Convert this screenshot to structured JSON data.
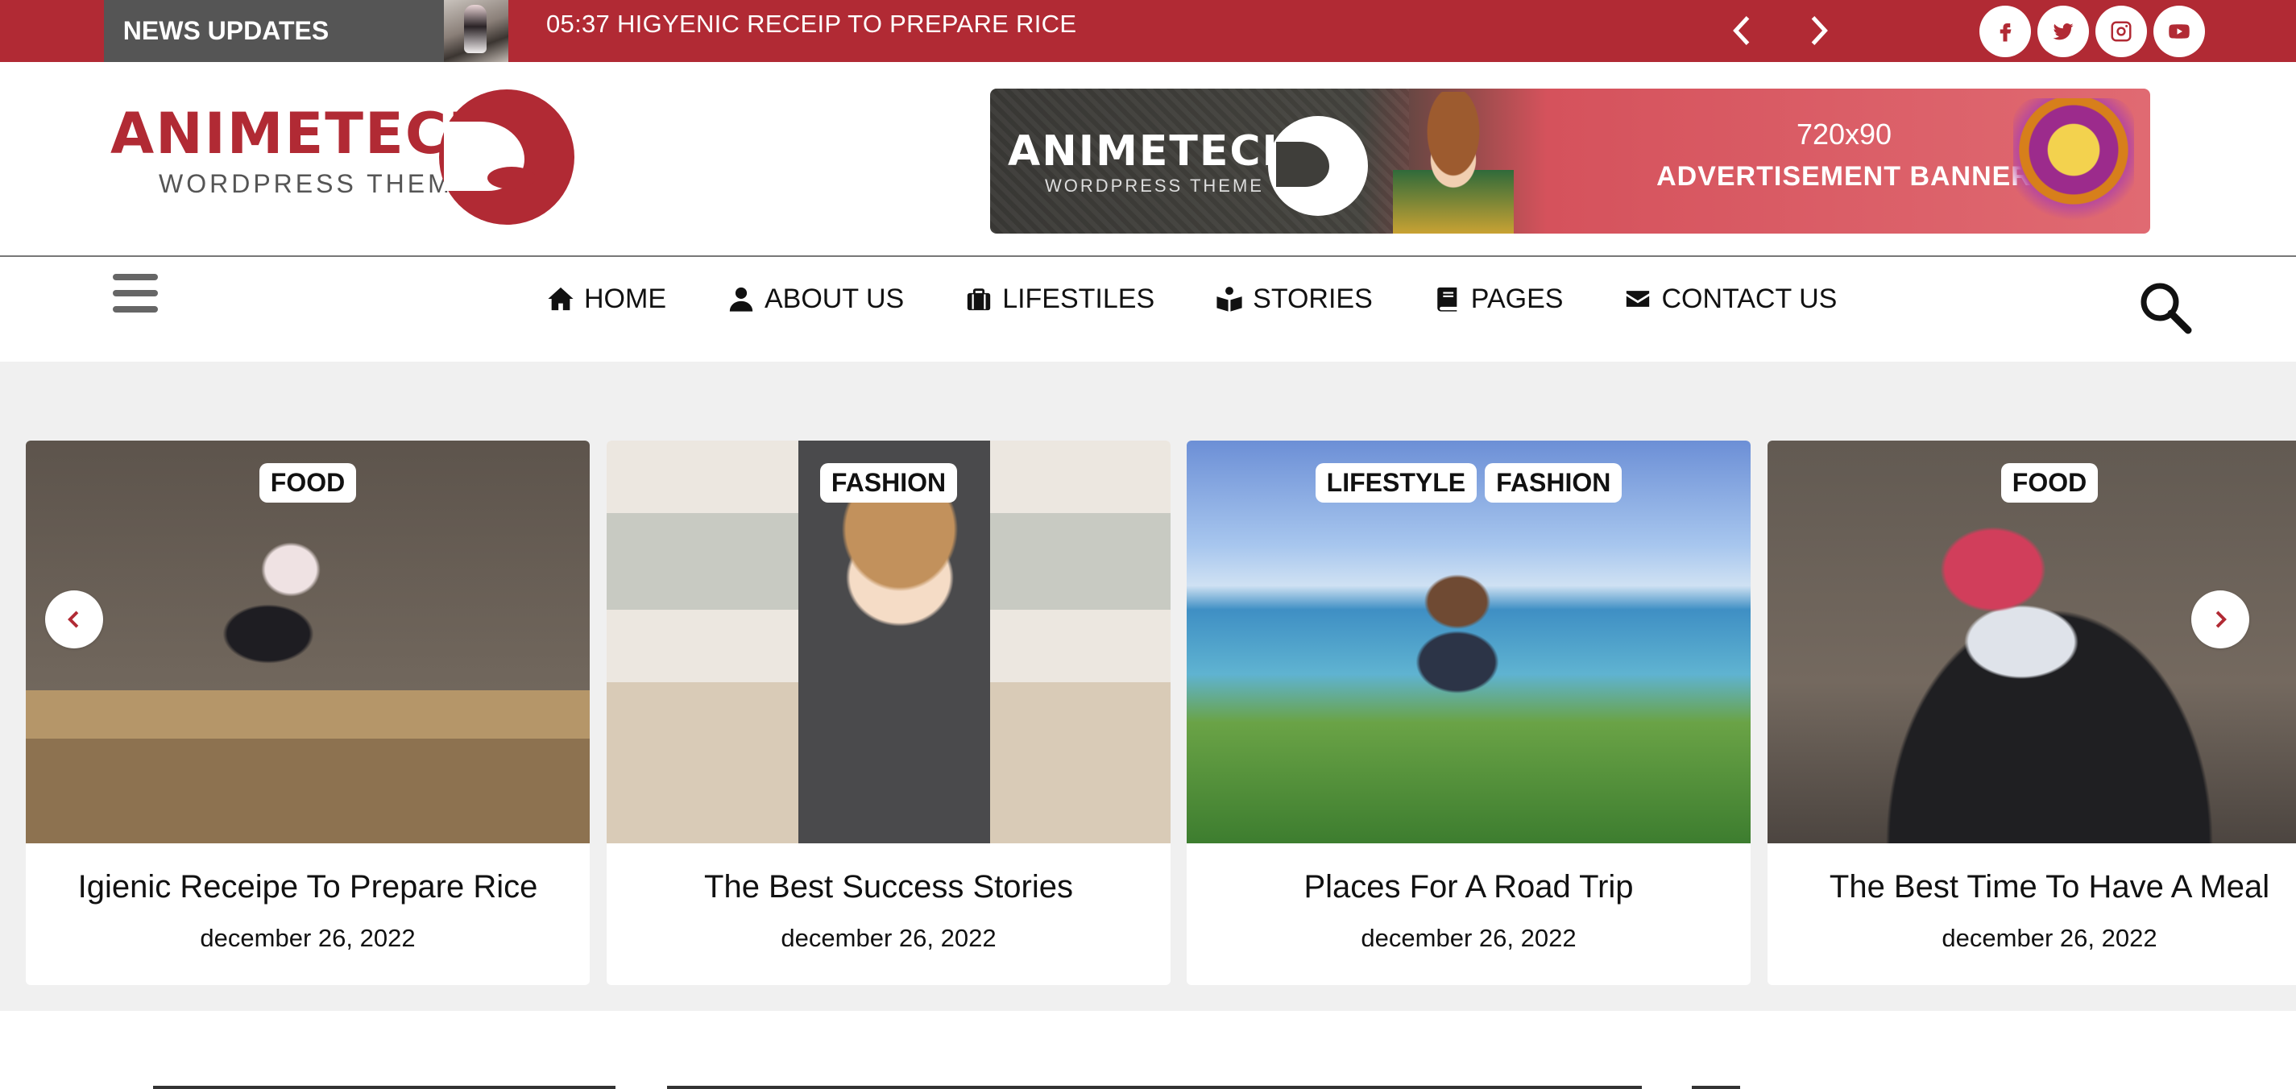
{
  "topbar": {
    "news_label": "NEWS UPDATES",
    "ticker_text": "05:37 HIGYENIC RECEIP TO PREPARE RICE",
    "prev_icon": "chevron-left-icon",
    "next_icon": "chevron-right-icon",
    "social": [
      "facebook-icon",
      "twitter-icon",
      "instagram-icon",
      "youtube-icon"
    ],
    "accent_color": "#b12a34"
  },
  "header": {
    "logo_text": "ANIMETECH",
    "logo_subtext": "WORDPRESS THEME",
    "banner": {
      "logo_text": "ANIMETECH",
      "logo_subtext": "WORDPRESS THEME",
      "size_text": "720x90",
      "ad_text": "ADVERTISEMENT BANNER"
    }
  },
  "nav": {
    "items": [
      {
        "label": "HOME",
        "icon": "home-icon"
      },
      {
        "label": "ABOUT US",
        "icon": "user-icon"
      },
      {
        "label": "LIFESTILES",
        "icon": "suitcase-icon"
      },
      {
        "label": "STORIES",
        "icon": "book-open-icon"
      },
      {
        "label": "PAGES",
        "icon": "book-icon"
      },
      {
        "label": "CONTACT US",
        "icon": "envelope-icon"
      }
    ],
    "menu_icon": "hamburger-icon",
    "search_icon": "search-icon"
  },
  "slider": {
    "cards": [
      {
        "tags": [
          "FOOD"
        ],
        "title": "Igienic Receipe To Prepare Rice",
        "date": "december 26, 2022"
      },
      {
        "tags": [
          "FASHION"
        ],
        "title": "The Best Success Stories",
        "date": "december 26, 2022"
      },
      {
        "tags": [
          "LIFESTYLE",
          "FASHION"
        ],
        "title": "Places For A Road Trip",
        "date": "december 26, 2022"
      },
      {
        "tags": [
          "FOOD"
        ],
        "title": "The Best Time To Have A Meal",
        "date": "december 26, 2022"
      }
    ]
  }
}
